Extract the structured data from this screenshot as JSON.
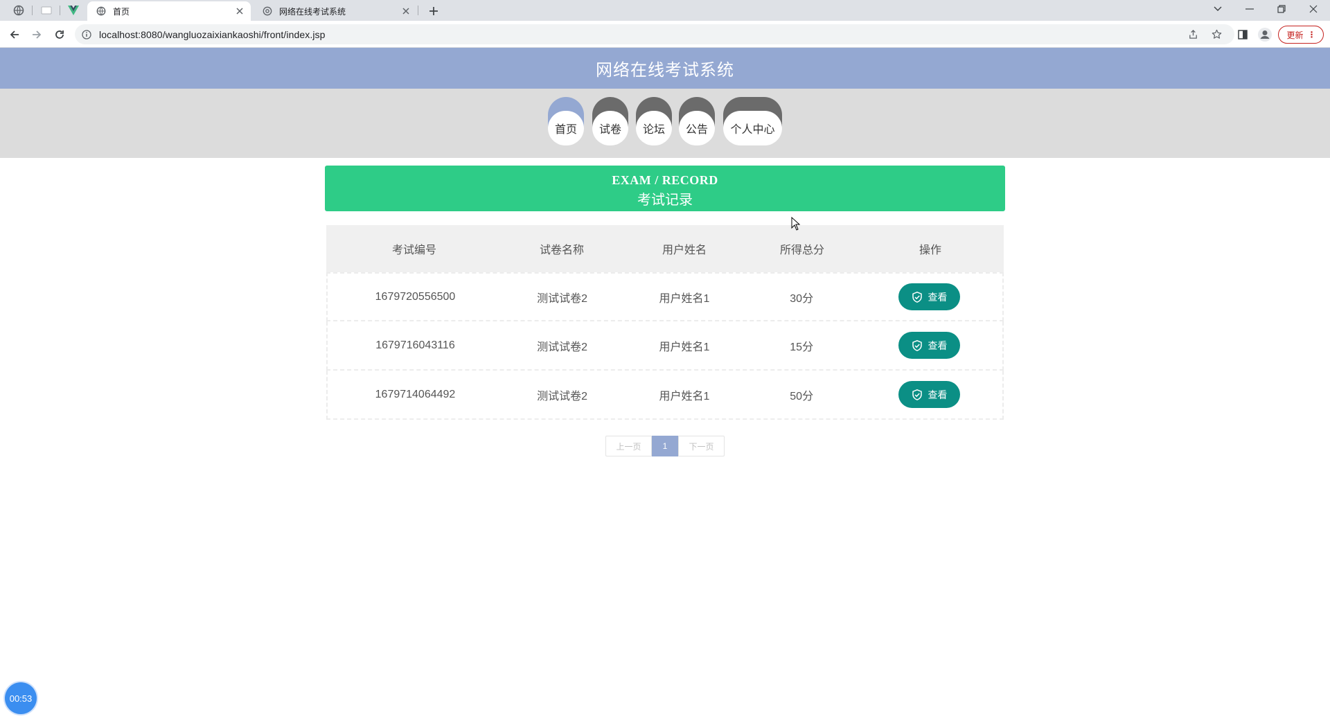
{
  "browser": {
    "tabs": [
      {
        "title": "首页",
        "active": true
      },
      {
        "title": "网络在线考试系统",
        "active": false
      }
    ],
    "url": "localhost:8080/wangluozaixiankaoshi/front/index.jsp",
    "update_label": "更新",
    "update_dots": "⋮"
  },
  "site": {
    "title": "网络在线考试系统"
  },
  "nav": {
    "items": [
      {
        "label": "首页",
        "active": true
      },
      {
        "label": "试卷",
        "active": false
      },
      {
        "label": "论坛",
        "active": false
      },
      {
        "label": "公告",
        "active": false
      },
      {
        "label": "个人中心",
        "active": false
      }
    ]
  },
  "banner": {
    "en": "EXAM / RECORD",
    "cn": "考试记录"
  },
  "table": {
    "headers": [
      "考试编号",
      "试卷名称",
      "用户姓名",
      "所得总分",
      "操作"
    ],
    "rows": [
      {
        "id": "1679720556500",
        "paper": "测试试卷2",
        "user": "用户姓名1",
        "score": "30分",
        "action": "查看"
      },
      {
        "id": "1679716043116",
        "paper": "测试试卷2",
        "user": "用户姓名1",
        "score": "15分",
        "action": "查看"
      },
      {
        "id": "1679714064492",
        "paper": "测试试卷2",
        "user": "用户姓名1",
        "score": "50分",
        "action": "查看"
      }
    ]
  },
  "pager": {
    "prev": "上一页",
    "current": "1",
    "next": "下一页"
  },
  "timer": "00:53",
  "colors": {
    "header": "#94a8d2",
    "banner": "#2ecc87",
    "action_button": "#0b8f85"
  }
}
